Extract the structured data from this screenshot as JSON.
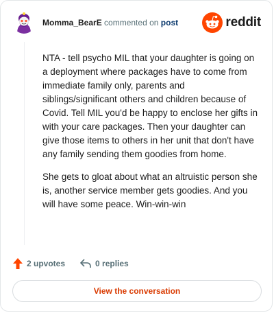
{
  "header": {
    "username": "Momma_BearE",
    "action_text": "commented on",
    "post_link": "post",
    "brand": "reddit",
    "avatar_icon": "snoo-avatar-icon",
    "brand_icon": "reddit-alien-icon",
    "brand_color": "#ff4500"
  },
  "comment": {
    "paragraphs": [
      "NTA - tell psycho MIL that your daughter is going on a deployment where packages have to come from immediate family only, parents and siblings/significant others and children because of Covid. Tell MIL you'd be happy to enclose her gifts in with your care packages. Then your daughter can give those items to others in her unit that don't have any family sending them goodies from home.",
      "She gets to gloat about what an altruistic person she is, another service member gets goodies. And you will have some peace. Win-win-win"
    ]
  },
  "actions": {
    "upvotes": "2 upvotes",
    "replies": "0 replies",
    "upvote_icon": "upvote-arrow-icon",
    "reply_icon": "reply-arrow-icon"
  },
  "footer": {
    "view_label": "View the conversation",
    "accent_color": "#d93a00"
  }
}
